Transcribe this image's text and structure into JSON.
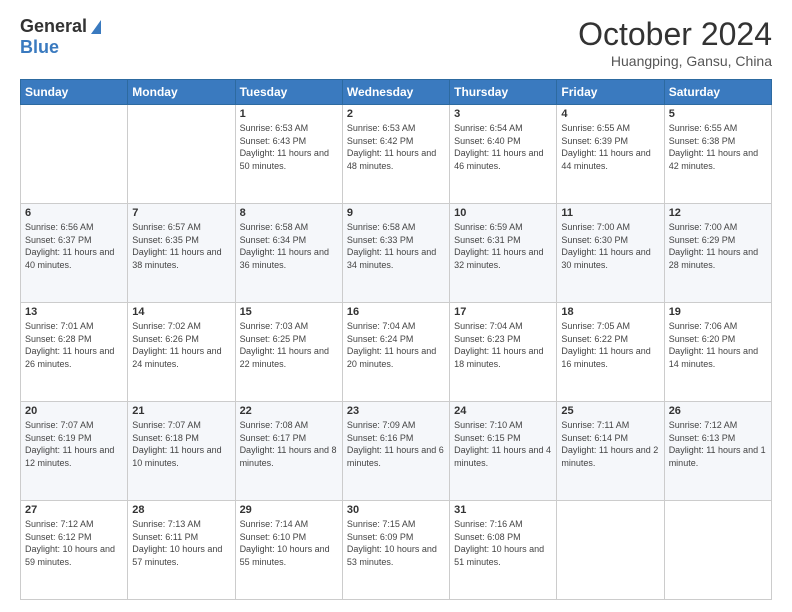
{
  "header": {
    "logo_general": "General",
    "logo_blue": "Blue",
    "month_title": "October 2024",
    "location": "Huangping, Gansu, China"
  },
  "days_of_week": [
    "Sunday",
    "Monday",
    "Tuesday",
    "Wednesday",
    "Thursday",
    "Friday",
    "Saturday"
  ],
  "weeks": [
    [
      {
        "day": "",
        "info": ""
      },
      {
        "day": "",
        "info": ""
      },
      {
        "day": "1",
        "info": "Sunrise: 6:53 AM\nSunset: 6:43 PM\nDaylight: 11 hours and 50 minutes."
      },
      {
        "day": "2",
        "info": "Sunrise: 6:53 AM\nSunset: 6:42 PM\nDaylight: 11 hours and 48 minutes."
      },
      {
        "day": "3",
        "info": "Sunrise: 6:54 AM\nSunset: 6:40 PM\nDaylight: 11 hours and 46 minutes."
      },
      {
        "day": "4",
        "info": "Sunrise: 6:55 AM\nSunset: 6:39 PM\nDaylight: 11 hours and 44 minutes."
      },
      {
        "day": "5",
        "info": "Sunrise: 6:55 AM\nSunset: 6:38 PM\nDaylight: 11 hours and 42 minutes."
      }
    ],
    [
      {
        "day": "6",
        "info": "Sunrise: 6:56 AM\nSunset: 6:37 PM\nDaylight: 11 hours and 40 minutes."
      },
      {
        "day": "7",
        "info": "Sunrise: 6:57 AM\nSunset: 6:35 PM\nDaylight: 11 hours and 38 minutes."
      },
      {
        "day": "8",
        "info": "Sunrise: 6:58 AM\nSunset: 6:34 PM\nDaylight: 11 hours and 36 minutes."
      },
      {
        "day": "9",
        "info": "Sunrise: 6:58 AM\nSunset: 6:33 PM\nDaylight: 11 hours and 34 minutes."
      },
      {
        "day": "10",
        "info": "Sunrise: 6:59 AM\nSunset: 6:31 PM\nDaylight: 11 hours and 32 minutes."
      },
      {
        "day": "11",
        "info": "Sunrise: 7:00 AM\nSunset: 6:30 PM\nDaylight: 11 hours and 30 minutes."
      },
      {
        "day": "12",
        "info": "Sunrise: 7:00 AM\nSunset: 6:29 PM\nDaylight: 11 hours and 28 minutes."
      }
    ],
    [
      {
        "day": "13",
        "info": "Sunrise: 7:01 AM\nSunset: 6:28 PM\nDaylight: 11 hours and 26 minutes."
      },
      {
        "day": "14",
        "info": "Sunrise: 7:02 AM\nSunset: 6:26 PM\nDaylight: 11 hours and 24 minutes."
      },
      {
        "day": "15",
        "info": "Sunrise: 7:03 AM\nSunset: 6:25 PM\nDaylight: 11 hours and 22 minutes."
      },
      {
        "day": "16",
        "info": "Sunrise: 7:04 AM\nSunset: 6:24 PM\nDaylight: 11 hours and 20 minutes."
      },
      {
        "day": "17",
        "info": "Sunrise: 7:04 AM\nSunset: 6:23 PM\nDaylight: 11 hours and 18 minutes."
      },
      {
        "day": "18",
        "info": "Sunrise: 7:05 AM\nSunset: 6:22 PM\nDaylight: 11 hours and 16 minutes."
      },
      {
        "day": "19",
        "info": "Sunrise: 7:06 AM\nSunset: 6:20 PM\nDaylight: 11 hours and 14 minutes."
      }
    ],
    [
      {
        "day": "20",
        "info": "Sunrise: 7:07 AM\nSunset: 6:19 PM\nDaylight: 11 hours and 12 minutes."
      },
      {
        "day": "21",
        "info": "Sunrise: 7:07 AM\nSunset: 6:18 PM\nDaylight: 11 hours and 10 minutes."
      },
      {
        "day": "22",
        "info": "Sunrise: 7:08 AM\nSunset: 6:17 PM\nDaylight: 11 hours and 8 minutes."
      },
      {
        "day": "23",
        "info": "Sunrise: 7:09 AM\nSunset: 6:16 PM\nDaylight: 11 hours and 6 minutes."
      },
      {
        "day": "24",
        "info": "Sunrise: 7:10 AM\nSunset: 6:15 PM\nDaylight: 11 hours and 4 minutes."
      },
      {
        "day": "25",
        "info": "Sunrise: 7:11 AM\nSunset: 6:14 PM\nDaylight: 11 hours and 2 minutes."
      },
      {
        "day": "26",
        "info": "Sunrise: 7:12 AM\nSunset: 6:13 PM\nDaylight: 11 hours and 1 minute."
      }
    ],
    [
      {
        "day": "27",
        "info": "Sunrise: 7:12 AM\nSunset: 6:12 PM\nDaylight: 10 hours and 59 minutes."
      },
      {
        "day": "28",
        "info": "Sunrise: 7:13 AM\nSunset: 6:11 PM\nDaylight: 10 hours and 57 minutes."
      },
      {
        "day": "29",
        "info": "Sunrise: 7:14 AM\nSunset: 6:10 PM\nDaylight: 10 hours and 55 minutes."
      },
      {
        "day": "30",
        "info": "Sunrise: 7:15 AM\nSunset: 6:09 PM\nDaylight: 10 hours and 53 minutes."
      },
      {
        "day": "31",
        "info": "Sunrise: 7:16 AM\nSunset: 6:08 PM\nDaylight: 10 hours and 51 minutes."
      },
      {
        "day": "",
        "info": ""
      },
      {
        "day": "",
        "info": ""
      }
    ]
  ]
}
